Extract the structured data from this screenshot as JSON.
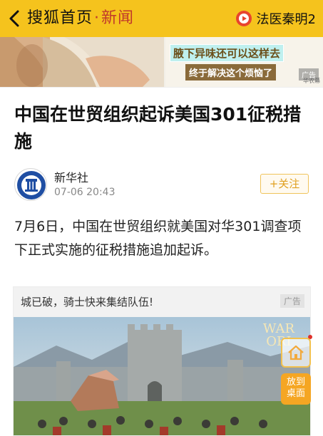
{
  "header": {
    "brand": "搜狐首页",
    "separator": "·",
    "section": "新闻",
    "video_label": "法医秦明2"
  },
  "top_ad": {
    "line1": "腋下异味还可以这样去",
    "line2": "终于解决这个烦恼了",
    "tag": "广告",
    "source": "华农幕"
  },
  "article": {
    "title": "中国在世贸组织起诉美国301征税措施",
    "author": "新华社",
    "time": "07-06 20:43",
    "follow_label": "+关注",
    "paragraph": "7月6日，中国在世贸组织就美国对华301调查项下正式实施的征税措施追加起诉。"
  },
  "game_ad": {
    "caption": "城已破，骑士快来集结队伍!",
    "tag": "广告",
    "logo_line1": "WAR",
    "logo_line2": "ORI"
  },
  "floating": {
    "desktop_label_1": "放到",
    "desktop_label_2": "桌面"
  },
  "colors": {
    "header_bg": "#f5c31d",
    "accent_red": "#c0392b",
    "follow": "#e0a020",
    "desktop_button": "#f5a623"
  },
  "icons": [
    "back-arrow-icon",
    "video-play-icon",
    "xinhua-logo-icon",
    "home-icon"
  ]
}
